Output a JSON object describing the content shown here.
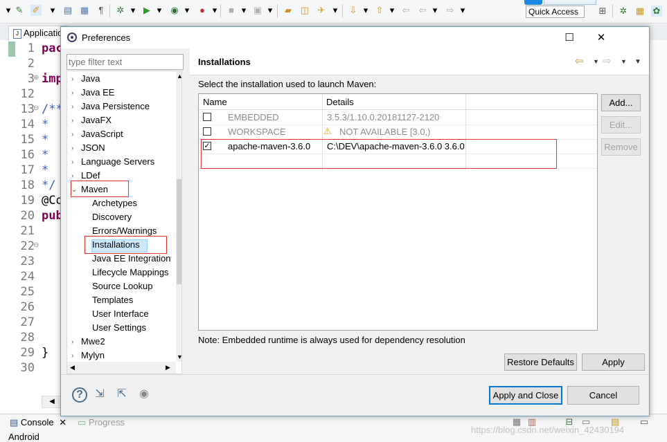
{
  "toolbar": {
    "quick_access": "Quick Access"
  },
  "editor": {
    "tab_label": "Applicatio",
    "lines": [
      {
        "n": "1",
        "code": "pac"
      },
      {
        "n": "2",
        "code": ""
      },
      {
        "n": "3",
        "code": "imp"
      },
      {
        "n": "12",
        "code": ""
      },
      {
        "n": "13",
        "code": "/**"
      },
      {
        "n": "14",
        "code": "*"
      },
      {
        "n": "15",
        "code": "*"
      },
      {
        "n": "16",
        "code": "*"
      },
      {
        "n": "17",
        "code": "*"
      },
      {
        "n": "18",
        "code": "*/"
      },
      {
        "n": "19",
        "code": "@Co"
      },
      {
        "n": "20",
        "code": "pub"
      },
      {
        "n": "21",
        "code": ""
      },
      {
        "n": "22",
        "code": ""
      },
      {
        "n": "23",
        "code": ""
      },
      {
        "n": "24",
        "code": ""
      },
      {
        "n": "25",
        "code": ""
      },
      {
        "n": "26",
        "code": ""
      },
      {
        "n": "27",
        "code": ""
      },
      {
        "n": "28",
        "code": ""
      },
      {
        "n": "29",
        "code": "}"
      },
      {
        "n": "30",
        "code": ""
      }
    ]
  },
  "bottom_panel": {
    "console_tab": "Console",
    "progress_tab": "Progress",
    "android": "Android",
    "watermark": "https://blog.csdn.net/weixin_42430194"
  },
  "dialog": {
    "title": "Preferences",
    "filter_placeholder": "type filter text",
    "tree": {
      "top_items": [
        "Java",
        "Java EE",
        "Java Persistence",
        "JavaFX",
        "JavaScript",
        "JSON",
        "Language Servers",
        "LDef"
      ],
      "expanded": "Maven",
      "children": [
        "Archetypes",
        "Discovery",
        "Errors/Warnings",
        "Installations",
        "Java EE Integration",
        "Lifecycle Mappings",
        "Source Lookup",
        "Templates",
        "User Interface",
        "User Settings"
      ],
      "after_items": [
        "Mwe2",
        "Mylyn"
      ]
    },
    "page": {
      "title": "Installations",
      "description": "Select the installation used to launch Maven:",
      "columns": [
        "Name",
        "Details"
      ],
      "rows": [
        {
          "name": "EMBEDDED",
          "details": "3.5.3/1.10.0.20181127-2120",
          "checked": false,
          "muted": true
        },
        {
          "name": "WORKSPACE",
          "details": "NOT AVAILABLE [3.0,)",
          "checked": false,
          "muted": true,
          "warning": true
        },
        {
          "name": "apache-maven-3.6.0",
          "details": "C:\\DEV\\apache-maven-3.6.0 3.6.0",
          "checked": true,
          "muted": false
        }
      ],
      "buttons": {
        "add": "Add...",
        "edit": "Edit...",
        "remove": "Remove"
      },
      "note": "Note: Embedded runtime is always used for dependency resolution",
      "restore_defaults": "Restore Defaults",
      "apply": "Apply"
    },
    "footer": {
      "apply_and_close": "Apply and Close",
      "cancel": "Cancel"
    }
  }
}
